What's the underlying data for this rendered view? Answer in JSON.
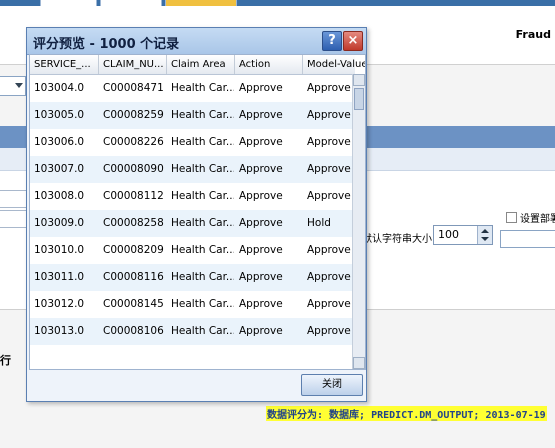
{
  "header": {
    "app_name": "Fraud"
  },
  "side": {
    "row_label": "行",
    "checkbox_label": "设置部署",
    "string_size_label": "默认字符串大小",
    "string_size_value": "100"
  },
  "status_bar": {
    "text": "数据评分为: 数据库; PREDICT.DM_OUTPUT; 2013-07-19"
  },
  "dialog": {
    "title": "评分预览 - 1000 个记录",
    "help_label": "?",
    "close_icon_label": "×",
    "close_button_label": "关闭",
    "columns": [
      "SERVICE_...",
      "CLAIM_NU...",
      "Claim Area",
      "Action",
      "Model-Value"
    ],
    "rows": [
      [
        "103004.0",
        "C00008471",
        "Health Car...",
        "Approve",
        "Approve"
      ],
      [
        "103005.0",
        "C00008259",
        "Health Car...",
        "Approve",
        "Approve"
      ],
      [
        "103006.0",
        "C00008226",
        "Health Car...",
        "Approve",
        "Approve"
      ],
      [
        "103007.0",
        "C00008090",
        "Health Car...",
        "Approve",
        "Approve"
      ],
      [
        "103008.0",
        "C00008112",
        "Health Car...",
        "Approve",
        "Approve"
      ],
      [
        "103009.0",
        "C00008258",
        "Health Car...",
        "Approve",
        "Hold"
      ],
      [
        "103010.0",
        "C00008209",
        "Health Car...",
        "Approve",
        "Approve"
      ],
      [
        "103011.0",
        "C00008116",
        "Health Car...",
        "Approve",
        "Approve"
      ],
      [
        "103012.0",
        "C00008145",
        "Health Car...",
        "Approve",
        "Approve"
      ],
      [
        "103013.0",
        "C00008106",
        "Health Car...",
        "Approve",
        "Approve"
      ]
    ]
  }
}
